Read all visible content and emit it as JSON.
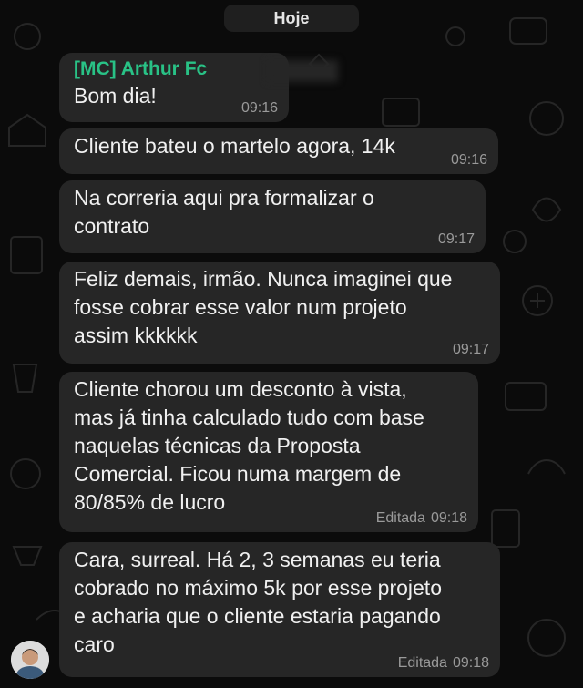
{
  "date_separator": "Hoje",
  "messages": [
    {
      "sender": "[MC] Arthur Fc",
      "text": "Bom dia!",
      "time": "09:16",
      "edited": ""
    },
    {
      "sender": "",
      "text": "Cliente bateu o martelo agora, 14k",
      "time": "09:16",
      "edited": ""
    },
    {
      "sender": "",
      "text": "Na correria aqui pra formalizar o\ncontrato",
      "time": "09:17",
      "edited": ""
    },
    {
      "sender": "",
      "text": "Feliz demais, irmão. Nunca imaginei que\nfosse cobrar esse valor num projeto\nassim kkkkkk",
      "time": "09:17",
      "edited": ""
    },
    {
      "sender": "",
      "text": "Cliente chorou um desconto à vista,\nmas já tinha calculado tudo com base\nnaquelas técnicas da Proposta\nComercial. Ficou numa margem de\n80/85% de lucro",
      "time": "09:18",
      "edited": "Editada"
    },
    {
      "sender": "",
      "text": "Cara, surreal. Há 2, 3 semanas eu teria\ncobrado no máximo 5k por esse projeto\ne acharia que o cliente estaria pagando\ncaro",
      "time": "09:18",
      "edited": "Editada"
    }
  ],
  "colors": {
    "background": "#0b0b0b",
    "bubble": "#262626",
    "sender_name": "#29c286",
    "timestamp": "#9a9a9a"
  }
}
